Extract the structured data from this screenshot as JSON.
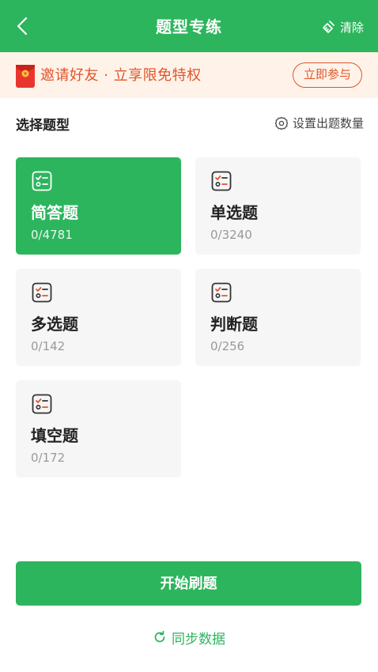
{
  "header": {
    "title": "题型专练",
    "clear_label": "清除"
  },
  "banner": {
    "text": "邀请好友 · 立享限免特权",
    "join_label": "立即参与"
  },
  "section": {
    "title": "选择题型",
    "set_count_label": "设置出题数量"
  },
  "question_types": [
    {
      "name": "简答题",
      "count": "0/4781",
      "selected": true
    },
    {
      "name": "单选题",
      "count": "0/3240",
      "selected": false
    },
    {
      "name": "多选题",
      "count": "0/142",
      "selected": false
    },
    {
      "name": "判断题",
      "count": "0/256",
      "selected": false
    },
    {
      "name": "填空题",
      "count": "0/172",
      "selected": false
    }
  ],
  "actions": {
    "start_label": "开始刷题",
    "sync_label": "同步数据"
  },
  "colors": {
    "brand_green": "#2db55d",
    "banner_bg": "#fff3e9",
    "banner_text": "#e0542b",
    "card_bg": "#f6f6f6"
  },
  "icons": {
    "back": "chevron-left-icon",
    "clear": "broom-icon",
    "banner": "red-packet-icon",
    "settings": "gear-icon",
    "card": "checklist-icon",
    "sync": "refresh-icon"
  }
}
